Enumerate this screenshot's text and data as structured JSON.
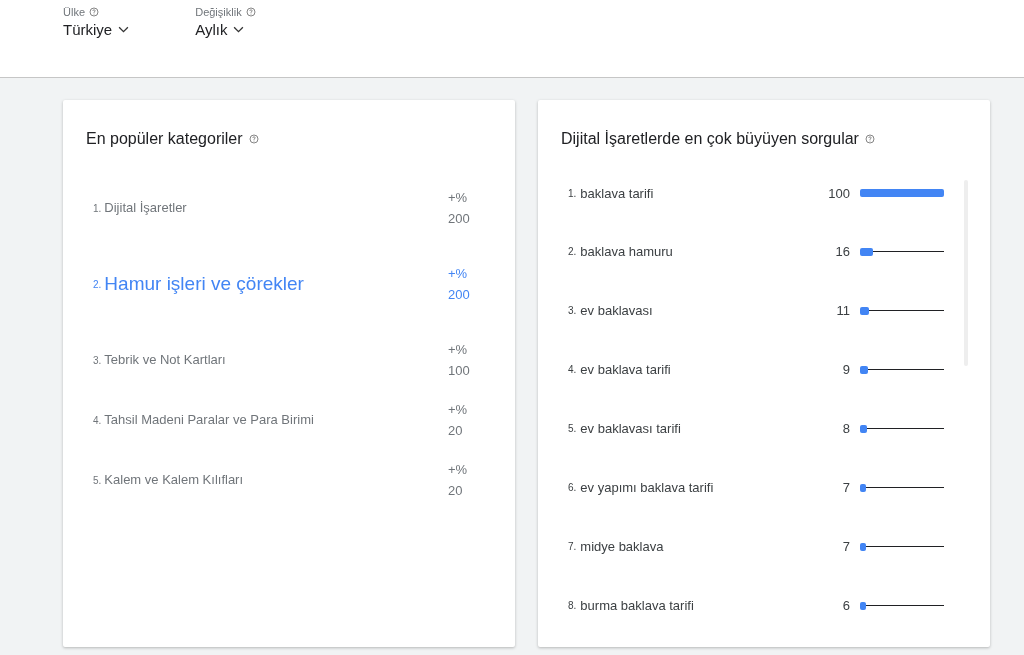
{
  "filters": [
    {
      "label": "Ülke",
      "value": "Türkiye"
    },
    {
      "label": "Değişiklik",
      "value": "Aylık"
    }
  ],
  "categories": {
    "title": "En popüler kategoriler",
    "items": [
      {
        "rank": "1.",
        "name": "Dijital İşaretler",
        "change": "+% 200",
        "selected": false
      },
      {
        "rank": "2.",
        "name": "Hamur işleri ve çörekler",
        "change": "+% 200",
        "selected": true
      },
      {
        "rank": "3.",
        "name": "Tebrik ve Not Kartları",
        "change": "+% 100",
        "selected": false
      },
      {
        "rank": "4.",
        "name": "Tahsil Madeni Paralar ve Para Birimi",
        "change": "+% 20",
        "selected": false
      },
      {
        "rank": "5.",
        "name": "Kalem ve Kalem Kılıfları",
        "change": "+% 20",
        "selected": false
      }
    ]
  },
  "queries": {
    "title": "Dijital İşaretlerde en çok büyüyen sorgular",
    "items": [
      {
        "rank": "1.",
        "name": "baklava tarifi",
        "value": "100",
        "level": 1
      },
      {
        "rank": "2.",
        "name": "baklava hamuru",
        "value": "16",
        "level": 0.16
      },
      {
        "rank": "3.",
        "name": "ev baklavası",
        "value": "11",
        "level": 0.11
      },
      {
        "rank": "4.",
        "name": "ev baklava tarifi",
        "value": "9",
        "level": 0.09
      },
      {
        "rank": "5.",
        "name": "ev baklavası tarifi",
        "value": "8",
        "level": 0.08
      },
      {
        "rank": "6.",
        "name": "ev yapımı baklava tarifi",
        "value": "7",
        "level": 0.07
      },
      {
        "rank": "7.",
        "name": "midye baklava",
        "value": "7",
        "level": 0.07
      },
      {
        "rank": "8.",
        "name": "burma baklava tarifi",
        "value": "6",
        "level": 0.06
      }
    ]
  }
}
